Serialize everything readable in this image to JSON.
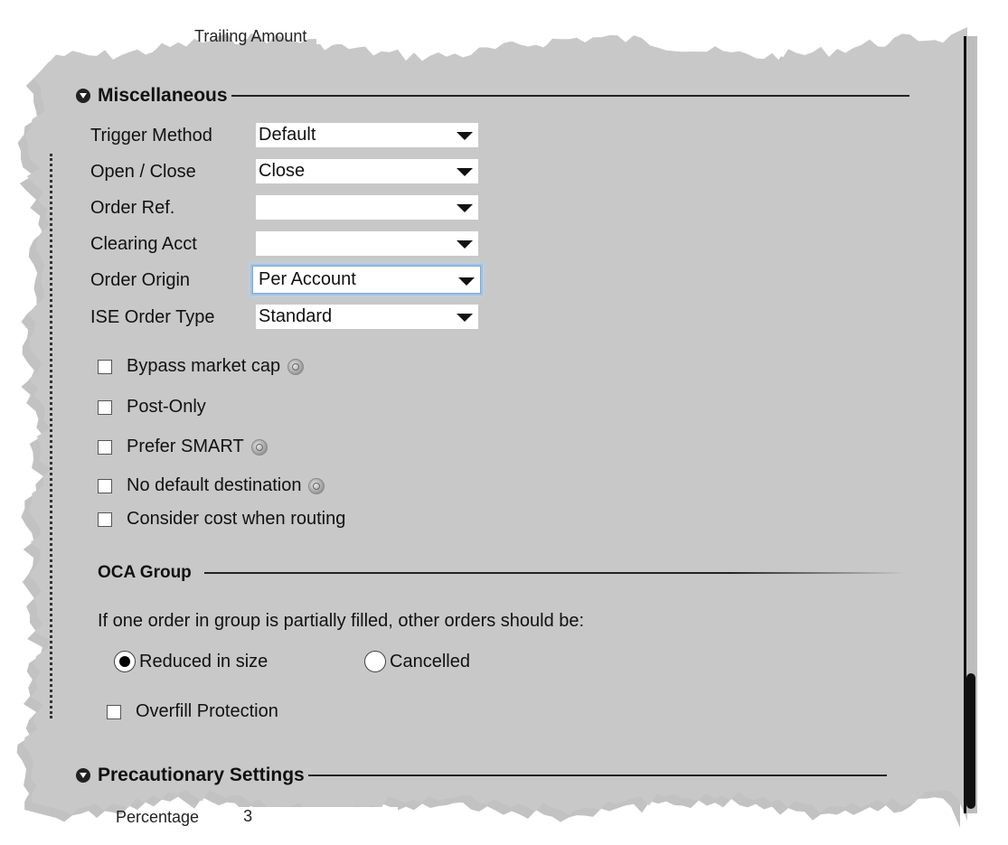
{
  "top_clipped": {
    "label": "Trailing Amount"
  },
  "miscellaneous": {
    "title": "Miscellaneous",
    "fields": [
      {
        "label": "Trigger Method",
        "value": "Default"
      },
      {
        "label": "Open / Close",
        "value": "Close"
      },
      {
        "label": "Order Ref.",
        "value": ""
      },
      {
        "label": "Clearing Acct",
        "value": ""
      },
      {
        "label": "Order Origin",
        "value": "Per Account"
      },
      {
        "label": "ISE Order Type",
        "value": "Standard"
      }
    ],
    "checkboxes": [
      {
        "label": "Bypass market cap",
        "checked": false,
        "help": true
      },
      {
        "label": "Post-Only",
        "checked": false,
        "help": false
      },
      {
        "label": "Prefer SMART",
        "checked": false,
        "help": true
      },
      {
        "label": "No default destination",
        "checked": false,
        "help": true
      },
      {
        "label": "Consider cost when routing",
        "checked": false,
        "help": false
      }
    ]
  },
  "oca_group": {
    "title": "OCA Group",
    "description": "If one order in group is partially filled, other orders should be:",
    "options": [
      {
        "label": "Reduced in size",
        "selected": true
      },
      {
        "label": "Cancelled",
        "selected": false
      }
    ],
    "overfill_label": "Overfill Protection",
    "overfill_checked": false
  },
  "precautionary": {
    "title": "Precautionary Settings",
    "first_field_label": "Percentage",
    "first_field_value": "3"
  },
  "colors": {
    "panel_bg": "#c8c8c8",
    "field_bg": "#ffffff",
    "focus_ring": "#9ec3e6",
    "text": "#111111"
  }
}
